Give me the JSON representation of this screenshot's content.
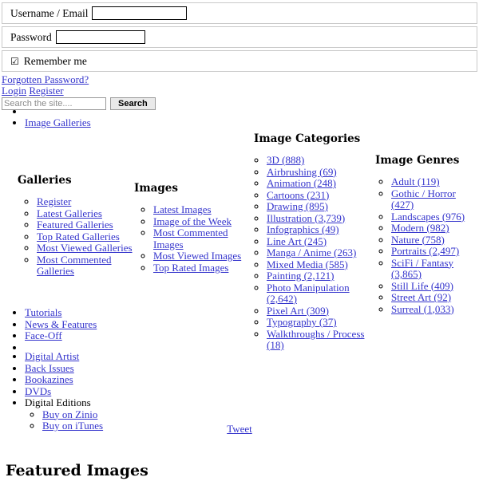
{
  "login_form": {
    "username_label": "Username / Email",
    "username_value": "",
    "username_placeholder": "",
    "password_label": "Password",
    "password_value": "",
    "password_placeholder": "",
    "remember_label": "Remember me",
    "remember_checked": true,
    "checkbox_glyph": "☑"
  },
  "auth_links": {
    "forgotten_password": "Forgotten Password?",
    "login": "Login",
    "register": "Register"
  },
  "search": {
    "placeholder": "Search the site....",
    "value": "",
    "button_label": "Search"
  },
  "menu_top": [
    {
      "label": ""
    },
    {
      "label": "Image Galleries"
    }
  ],
  "panels": {
    "galleries": {
      "heading": "Galleries",
      "items": [
        "Register",
        "Latest Galleries",
        "Featured Galleries",
        "Top Rated Galleries",
        "Most Viewed Galleries",
        "Most Commented Galleries"
      ]
    },
    "images": {
      "heading": "Images",
      "items": [
        "Latest Images",
        "Image of the Week",
        "Most Commented Images",
        "Most Viewed Images",
        "Top Rated Images"
      ]
    },
    "categories": {
      "heading": "Image Categories",
      "items": [
        "3D (888)",
        "Airbrushing (69)",
        "Animation (248)",
        "Cartoons (231)",
        "Drawing (895)",
        "Illustration (3,739)",
        "Infographics (49)",
        "Line Art (245)",
        "Manga / Anime (263)",
        "Mixed Media (585)",
        "Painting (2,121)",
        "Photo Manipulation (2,642)",
        "Pixel Art (309)",
        "Typography (37)",
        "Walkthroughs / Process (18)"
      ]
    },
    "genres": {
      "heading": "Image Genres",
      "items": [
        "Adult (119)",
        "Gothic / Horror (427)",
        "Landscapes (976)",
        "Modern (982)",
        "Nature (758)",
        "Portraits (2,497)",
        "SciFi / Fantasy (3,865)",
        "Still Life (409)",
        "Street Art (92)",
        "Surreal (1,033)"
      ]
    }
  },
  "menu_mid": [
    {
      "label": "Tutorials"
    },
    {
      "label": "News & Features"
    },
    {
      "label": "Face-Off"
    },
    {
      "label": ""
    }
  ],
  "menu_bottom": [
    {
      "label": "Digital Artist"
    },
    {
      "label": "Back Issues"
    },
    {
      "label": "Bookazines"
    },
    {
      "label": "DVDs"
    },
    {
      "label": "Digital Editions"
    }
  ],
  "digital_editions_sub": [
    "Buy on Zinio",
    "Buy on iTunes"
  ],
  "social": {
    "tweet_label": "Tweet"
  },
  "featured": {
    "heading": "Featured Images"
  },
  "colors": {
    "link": "#3333cc",
    "text": "#000000",
    "background": "#ffffff",
    "form_border": "#c9c9c9",
    "placeholder": "#8a8a8a"
  }
}
